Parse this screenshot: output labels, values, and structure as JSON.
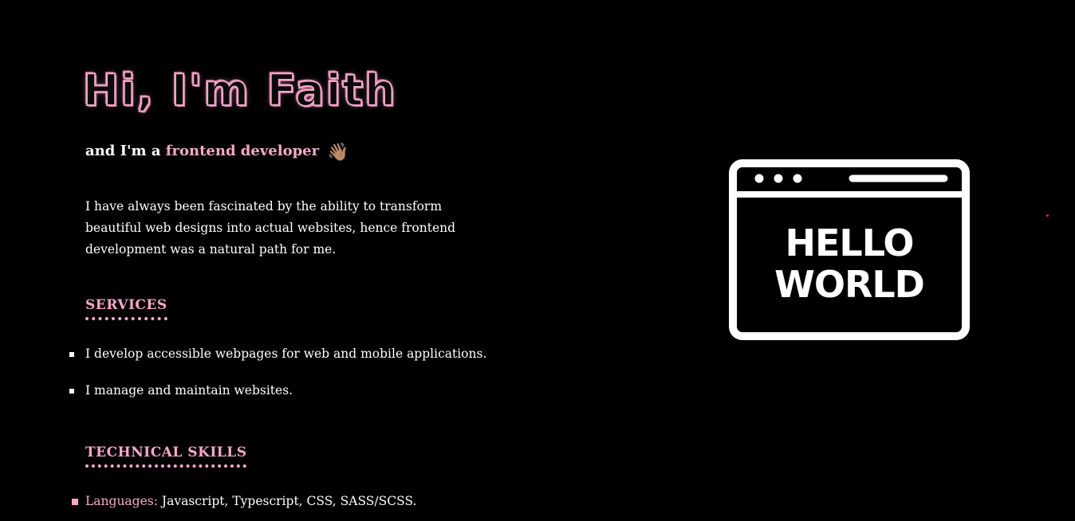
{
  "hero": {
    "title": "Hi, I'm Faith",
    "subtitle_prefix": "and I'm a ",
    "subtitle_role": "frontend developer",
    "wave_emoji": "👋🏽"
  },
  "intro": {
    "text": "I have always been fascinated by the ability to transform beautiful web designs into actual websites, hence frontend development was a natural path for me."
  },
  "services": {
    "heading": "SERVICES",
    "items": [
      "I develop accessible webpages for web and mobile applications.",
      "I manage and maintain websites."
    ]
  },
  "skills": {
    "heading": "TECHNICAL SKILLS",
    "languages_label": "Languages:",
    "languages_value": " Javascript, Typescript, CSS, SASS/SCSS."
  },
  "illustration": {
    "icon": "browser-window-icon",
    "line1": "HELLO",
    "line2": "WORLD"
  },
  "colors": {
    "background": "#000000",
    "accent_pink": "#f6a9ca",
    "text": "#ffffff"
  }
}
